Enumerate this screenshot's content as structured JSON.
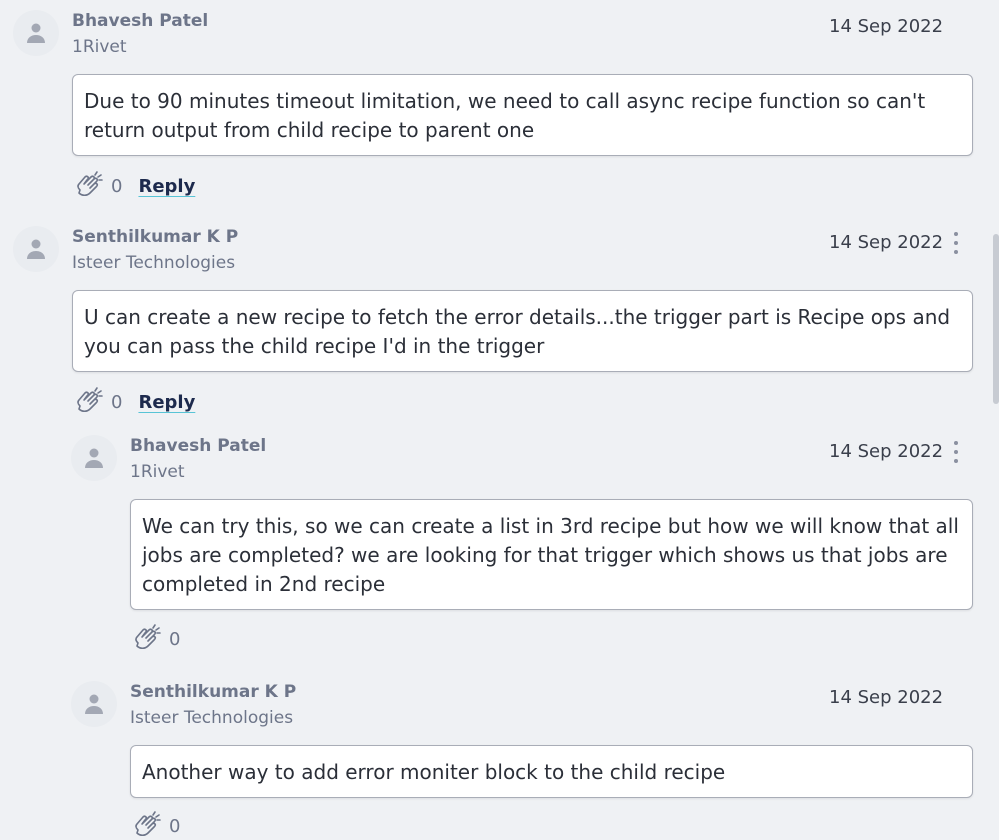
{
  "comments": [
    {
      "author": "Bhavesh Patel",
      "company": "1Rivet",
      "date": "14 Sep 2022",
      "text": "Due to 90 minutes timeout limitation, we need to call async recipe function so can't return output from child recipe to parent one",
      "claps": "0",
      "reply_label": "Reply",
      "has_menu": false
    },
    {
      "author": "Senthilkumar K P",
      "company": "Isteer Technologies",
      "date": "14 Sep 2022",
      "text": "U can create a new recipe to fetch the error details...the trigger part is Recipe ops and you can pass the child recipe I'd in the trigger",
      "claps": "0",
      "reply_label": "Reply",
      "has_menu": true
    },
    {
      "author": "Bhavesh Patel",
      "company": "1Rivet",
      "date": "14 Sep 2022",
      "text": "We can try this, so we can create a list in 3rd recipe but how we will know that all jobs are completed? we are looking for that trigger which shows us that jobs are completed in 2nd recipe",
      "claps": "0",
      "has_menu": true
    },
    {
      "author": "Senthilkumar K P",
      "company": "Isteer Technologies",
      "date": "14 Sep 2022",
      "text": "Another way to add error moniter block to the child recipe",
      "claps": "0",
      "has_menu": false
    }
  ],
  "icons": {
    "avatar": "user-placeholder-icon",
    "clap": "clap-icon",
    "more": "more-vertical-icon"
  },
  "colors": {
    "background": "#eff1f4",
    "reply_underline": "#58c4d6",
    "meta_text": "#6d7589"
  }
}
